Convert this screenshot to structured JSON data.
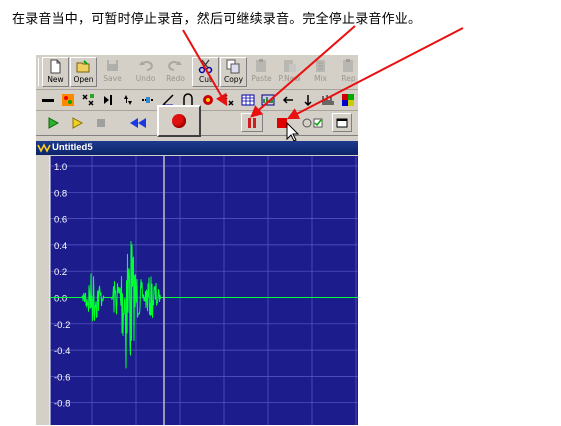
{
  "caption": "在录音当中，可暂时停止录音，然后可继续录音。完全停止录音作业。",
  "toolbar": {
    "buttons": [
      {
        "label": "New",
        "icon": "new-file-icon",
        "enabled": true
      },
      {
        "label": "Open",
        "icon": "open-folder-icon",
        "enabled": true
      },
      {
        "label": "Save",
        "icon": "save-icon",
        "enabled": false
      },
      {
        "label": "Undo",
        "icon": "undo-icon",
        "enabled": false
      },
      {
        "label": "Redo",
        "icon": "redo-icon",
        "enabled": false
      },
      {
        "label": "Cut",
        "icon": "scissors-icon",
        "enabled": true
      },
      {
        "label": "Copy",
        "icon": "copy-icon",
        "enabled": true
      },
      {
        "label": "Paste",
        "icon": "paste-icon",
        "enabled": false
      },
      {
        "label": "P.New",
        "icon": "paste-new-icon",
        "enabled": false
      },
      {
        "label": "Mix",
        "icon": "mix-icon",
        "enabled": false
      },
      {
        "label": "Rep",
        "icon": "replace-icon",
        "enabled": false
      }
    ]
  },
  "transport": {
    "record_tooltip_icon": "record-icon",
    "stop_color": "#e00000",
    "pause_color": "#cc2020"
  },
  "document": {
    "title": "Untitled5"
  },
  "waveform": {
    "background": "#1c1c8c",
    "wave_color": "#00ff33",
    "y_labels": [
      "1.0",
      "0.8",
      "0.6",
      "0.4",
      "0.2",
      "0.0",
      "-0.2",
      "-0.4",
      "-0.6",
      "-0.8"
    ]
  },
  "colors": {
    "arrow": "#e81010",
    "title_bar": "#0a246a",
    "toolbar_bg": "#d4d0c8"
  }
}
